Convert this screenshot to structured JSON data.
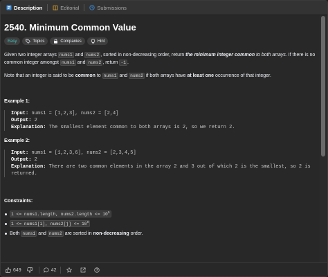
{
  "tabs": [
    {
      "label": "Description"
    },
    {
      "label": "Editorial"
    },
    {
      "label": "Submissions"
    }
  ],
  "problem": {
    "title": "2540. Minimum Common Value",
    "difficulty": "Easy",
    "chips": [
      "Topics",
      "Companies",
      "Hint"
    ],
    "desc1_a": "Given two integer arrays ",
    "nums1": "nums1",
    "and": " and ",
    "nums2": "nums2",
    "desc1_b": ", sorted in non-decreasing order, return ",
    "desc1_em": "the minimum integer common",
    "desc1_c": " to both arrays",
    "desc1_d": ". If there is no common integer amongst ",
    "desc1_e": ", return ",
    "minus_one": "-1",
    "period": ".",
    "note_a": "Note that an integer is said to be ",
    "note_b": "common",
    "note_c": " to ",
    "note_d": " if both arrays have ",
    "note_e": "at least one",
    "note_f": " occurrence of that integer."
  },
  "examples": [
    {
      "heading": "Example 1:",
      "input_label": "Input:",
      "input": " nums1 = [1,2,3], nums2 = [2,4]",
      "output_label": "Output:",
      "output": " 2",
      "explanation_label": "Explanation:",
      "explanation": " The smallest element common to both arrays is 2, so we return 2.",
      "explanation2": ""
    },
    {
      "heading": "Example 2:",
      "input_label": "Input:",
      "input": " nums1 = [1,2,3,6], nums2 = [2,3,4,5]",
      "output_label": "Output:",
      "output": " 2",
      "explanation_label": "Explanation:",
      "explanation": " There are two common elements in the array 2 and 3 out of which 2 is the smallest, so 2 is",
      "explanation2": "returned."
    }
  ],
  "constraints": {
    "heading": "Constraints:",
    "c1": "1 <= nums1.length, nums2.length <= 10",
    "c1_sup": "5",
    "c2": "1 <= nums1[i], nums2[j] <= 10",
    "c2_sup": "9",
    "c3_a": "Both ",
    "c3_b": " are sorted in ",
    "c3_c": "non-decreasing",
    "c3_d": " order."
  },
  "footer": {
    "likes": "649",
    "comments": "42"
  },
  "colors": {
    "easy": "#46c6c2",
    "background": "#282828",
    "description_icon": "#3a8dde",
    "editorial_icon": "#e8a92e",
    "submissions_icon": "#3a8dde"
  },
  "icons": [
    "description-icon",
    "editorial-icon",
    "submissions-icon",
    "topics-icon",
    "lock-icon",
    "hint-icon",
    "thumbs-up-icon",
    "thumbs-down-icon",
    "comment-icon",
    "star-icon",
    "share-icon",
    "help-icon"
  ]
}
